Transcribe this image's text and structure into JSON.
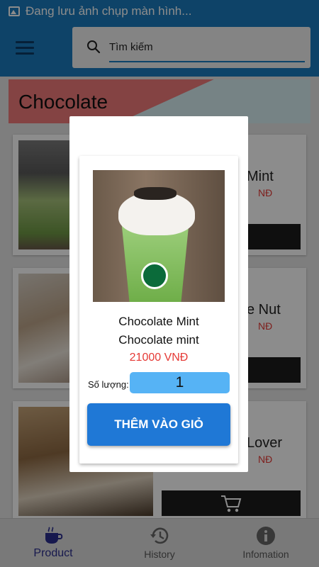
{
  "statusbar": {
    "notification_text": "Đang lưu ảnh chụp màn hình..."
  },
  "appbar": {
    "search_placeholder": "Tìm kiếm"
  },
  "category": {
    "title": "Chocolate"
  },
  "products": [
    {
      "name_partial": "Mint",
      "price_partial": "NĐ"
    },
    {
      "name_partial": "e Nut",
      "price_partial": "NĐ"
    },
    {
      "name_partial": "Lover",
      "price_partial": "NĐ"
    }
  ],
  "dialog": {
    "product_name": "Chocolate Mint",
    "product_description": "Chocolate mint",
    "price": "21000 VNĐ",
    "quantity_label": "Số lượng:",
    "quantity_value": "1",
    "add_to_cart_label": "THÊM VÀO GIỎ"
  },
  "bottom_nav": [
    {
      "label": "Product",
      "icon": "coffee-cup-icon",
      "active": true
    },
    {
      "label": "History",
      "icon": "history-icon",
      "active": false
    },
    {
      "label": "Infomation",
      "icon": "info-icon",
      "active": false
    }
  ],
  "colors": {
    "primary": "#1a7bbd",
    "price_red": "#e53935",
    "button_blue": "#1f78d6",
    "quantity_blue": "#56b3f5",
    "nav_active": "#2b2f8f"
  }
}
